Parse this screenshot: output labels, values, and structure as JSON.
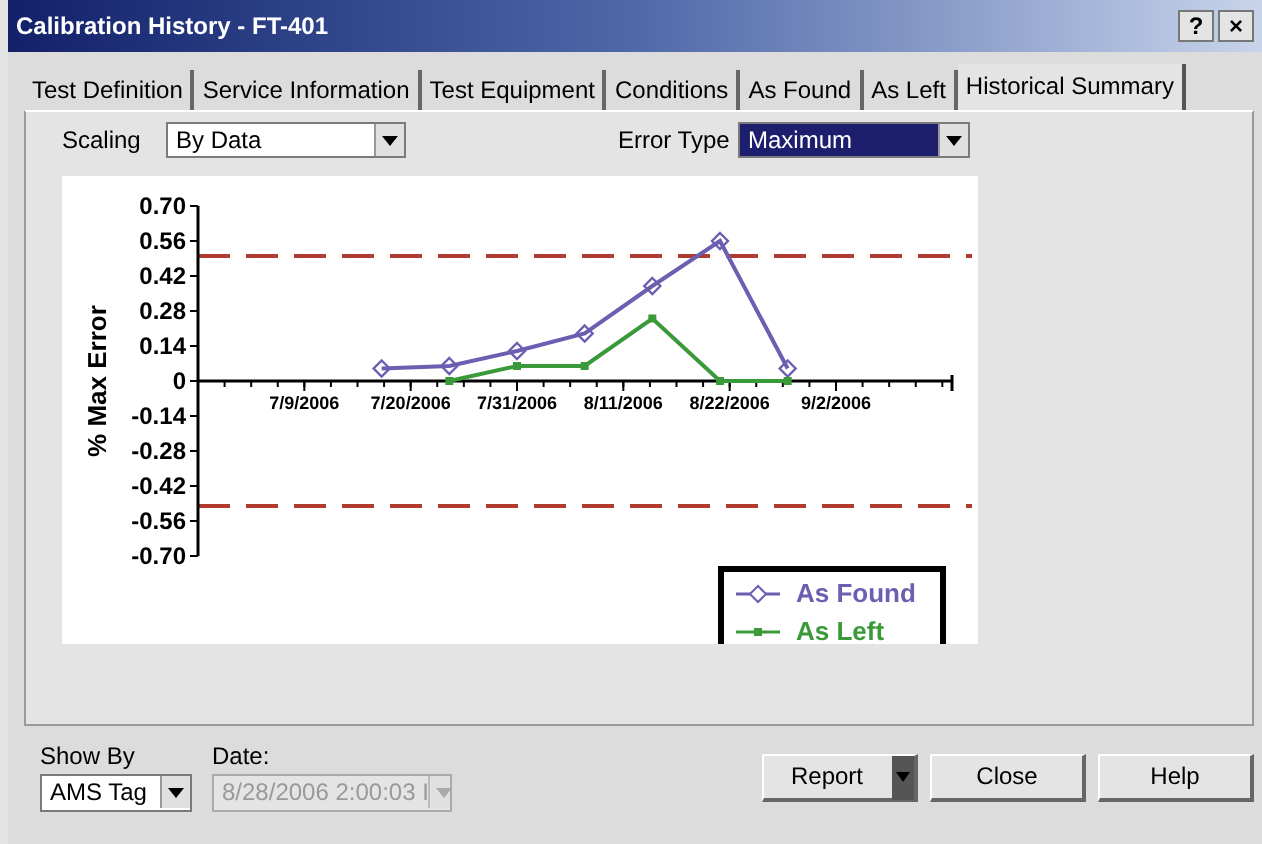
{
  "window": {
    "title": "Calibration History -  FT-401",
    "title_buttons": [
      "?",
      "×"
    ]
  },
  "tabs": [
    {
      "label": "Test Definition",
      "selected": false
    },
    {
      "label": "Service Information",
      "selected": false
    },
    {
      "label": "Test Equipment",
      "selected": false
    },
    {
      "label": "Conditions",
      "selected": false
    },
    {
      "label": "As Found",
      "selected": false
    },
    {
      "label": "As Left",
      "selected": false
    },
    {
      "label": "Historical Summary",
      "selected": true
    }
  ],
  "scaling": {
    "label": "Scaling",
    "value": "By Data"
  },
  "error_type": {
    "label": "Error Type",
    "value": "Maximum"
  },
  "chart": {
    "chart_data": {
      "type": "line",
      "ylabel": "% Max Error",
      "xlim": [
        "2006-06-28",
        "2006-09-14"
      ],
      "ylim": [
        -0.7,
        0.7
      ],
      "x": [
        "2006-07-17",
        "2006-07-24",
        "2006-07-31",
        "2006-08-07",
        "2006-08-14",
        "2006-08-21",
        "2006-08-28"
      ],
      "xticks": [
        {
          "value": "2006-07-09",
          "label": "7/9/2006"
        },
        {
          "value": "2006-07-20",
          "label": "7/20/2006"
        },
        {
          "value": "2006-07-31",
          "label": "7/31/2006"
        },
        {
          "value": "2006-08-11",
          "label": "8/11/2006"
        },
        {
          "value": "2006-08-22",
          "label": "8/22/2006"
        },
        {
          "value": "2006-09-02",
          "label": "9/2/2006"
        }
      ],
      "yticks": [
        {
          "value": 0.7,
          "label": "0.70"
        },
        {
          "value": 0.56,
          "label": "0.56"
        },
        {
          "value": 0.42,
          "label": "0.42"
        },
        {
          "value": 0.28,
          "label": "0.28"
        },
        {
          "value": 0.14,
          "label": "0.14"
        },
        {
          "value": 0,
          "label": "0"
        },
        {
          "value": -0.14,
          "label": "-0.14"
        },
        {
          "value": -0.28,
          "label": "-0.28"
        },
        {
          "value": -0.42,
          "label": "-0.42"
        },
        {
          "value": -0.56,
          "label": "-0.56"
        },
        {
          "value": -0.7,
          "label": "-0.70"
        }
      ],
      "series": [
        {
          "name": "As Found",
          "color": "#6a5fb0",
          "marker": "diamond",
          "values": [
            0.05,
            0.06,
            0.12,
            0.19,
            0.38,
            0.56,
            0.05
          ]
        },
        {
          "name": "As Left",
          "color": "#3a9a3a",
          "marker": "square",
          "values": [
            null,
            0,
            0.06,
            0.06,
            0.25,
            0,
            0
          ]
        }
      ],
      "ref_lines": [
        {
          "axis": "y",
          "value": 0.5,
          "color": "#b03a2e"
        },
        {
          "axis": "y",
          "value": -0.5,
          "color": "#b03a2e"
        }
      ],
      "legend": true
    }
  },
  "show_by": {
    "label": "Show By",
    "value": "AMS Tag"
  },
  "date": {
    "label": "Date:",
    "value": "8/28/2006 2:00:03 I",
    "disabled": true
  },
  "buttons": [
    {
      "label": "Report",
      "kind": "split"
    },
    {
      "label": "Close",
      "kind": "plain"
    },
    {
      "label": "Help",
      "kind": "plain"
    }
  ]
}
